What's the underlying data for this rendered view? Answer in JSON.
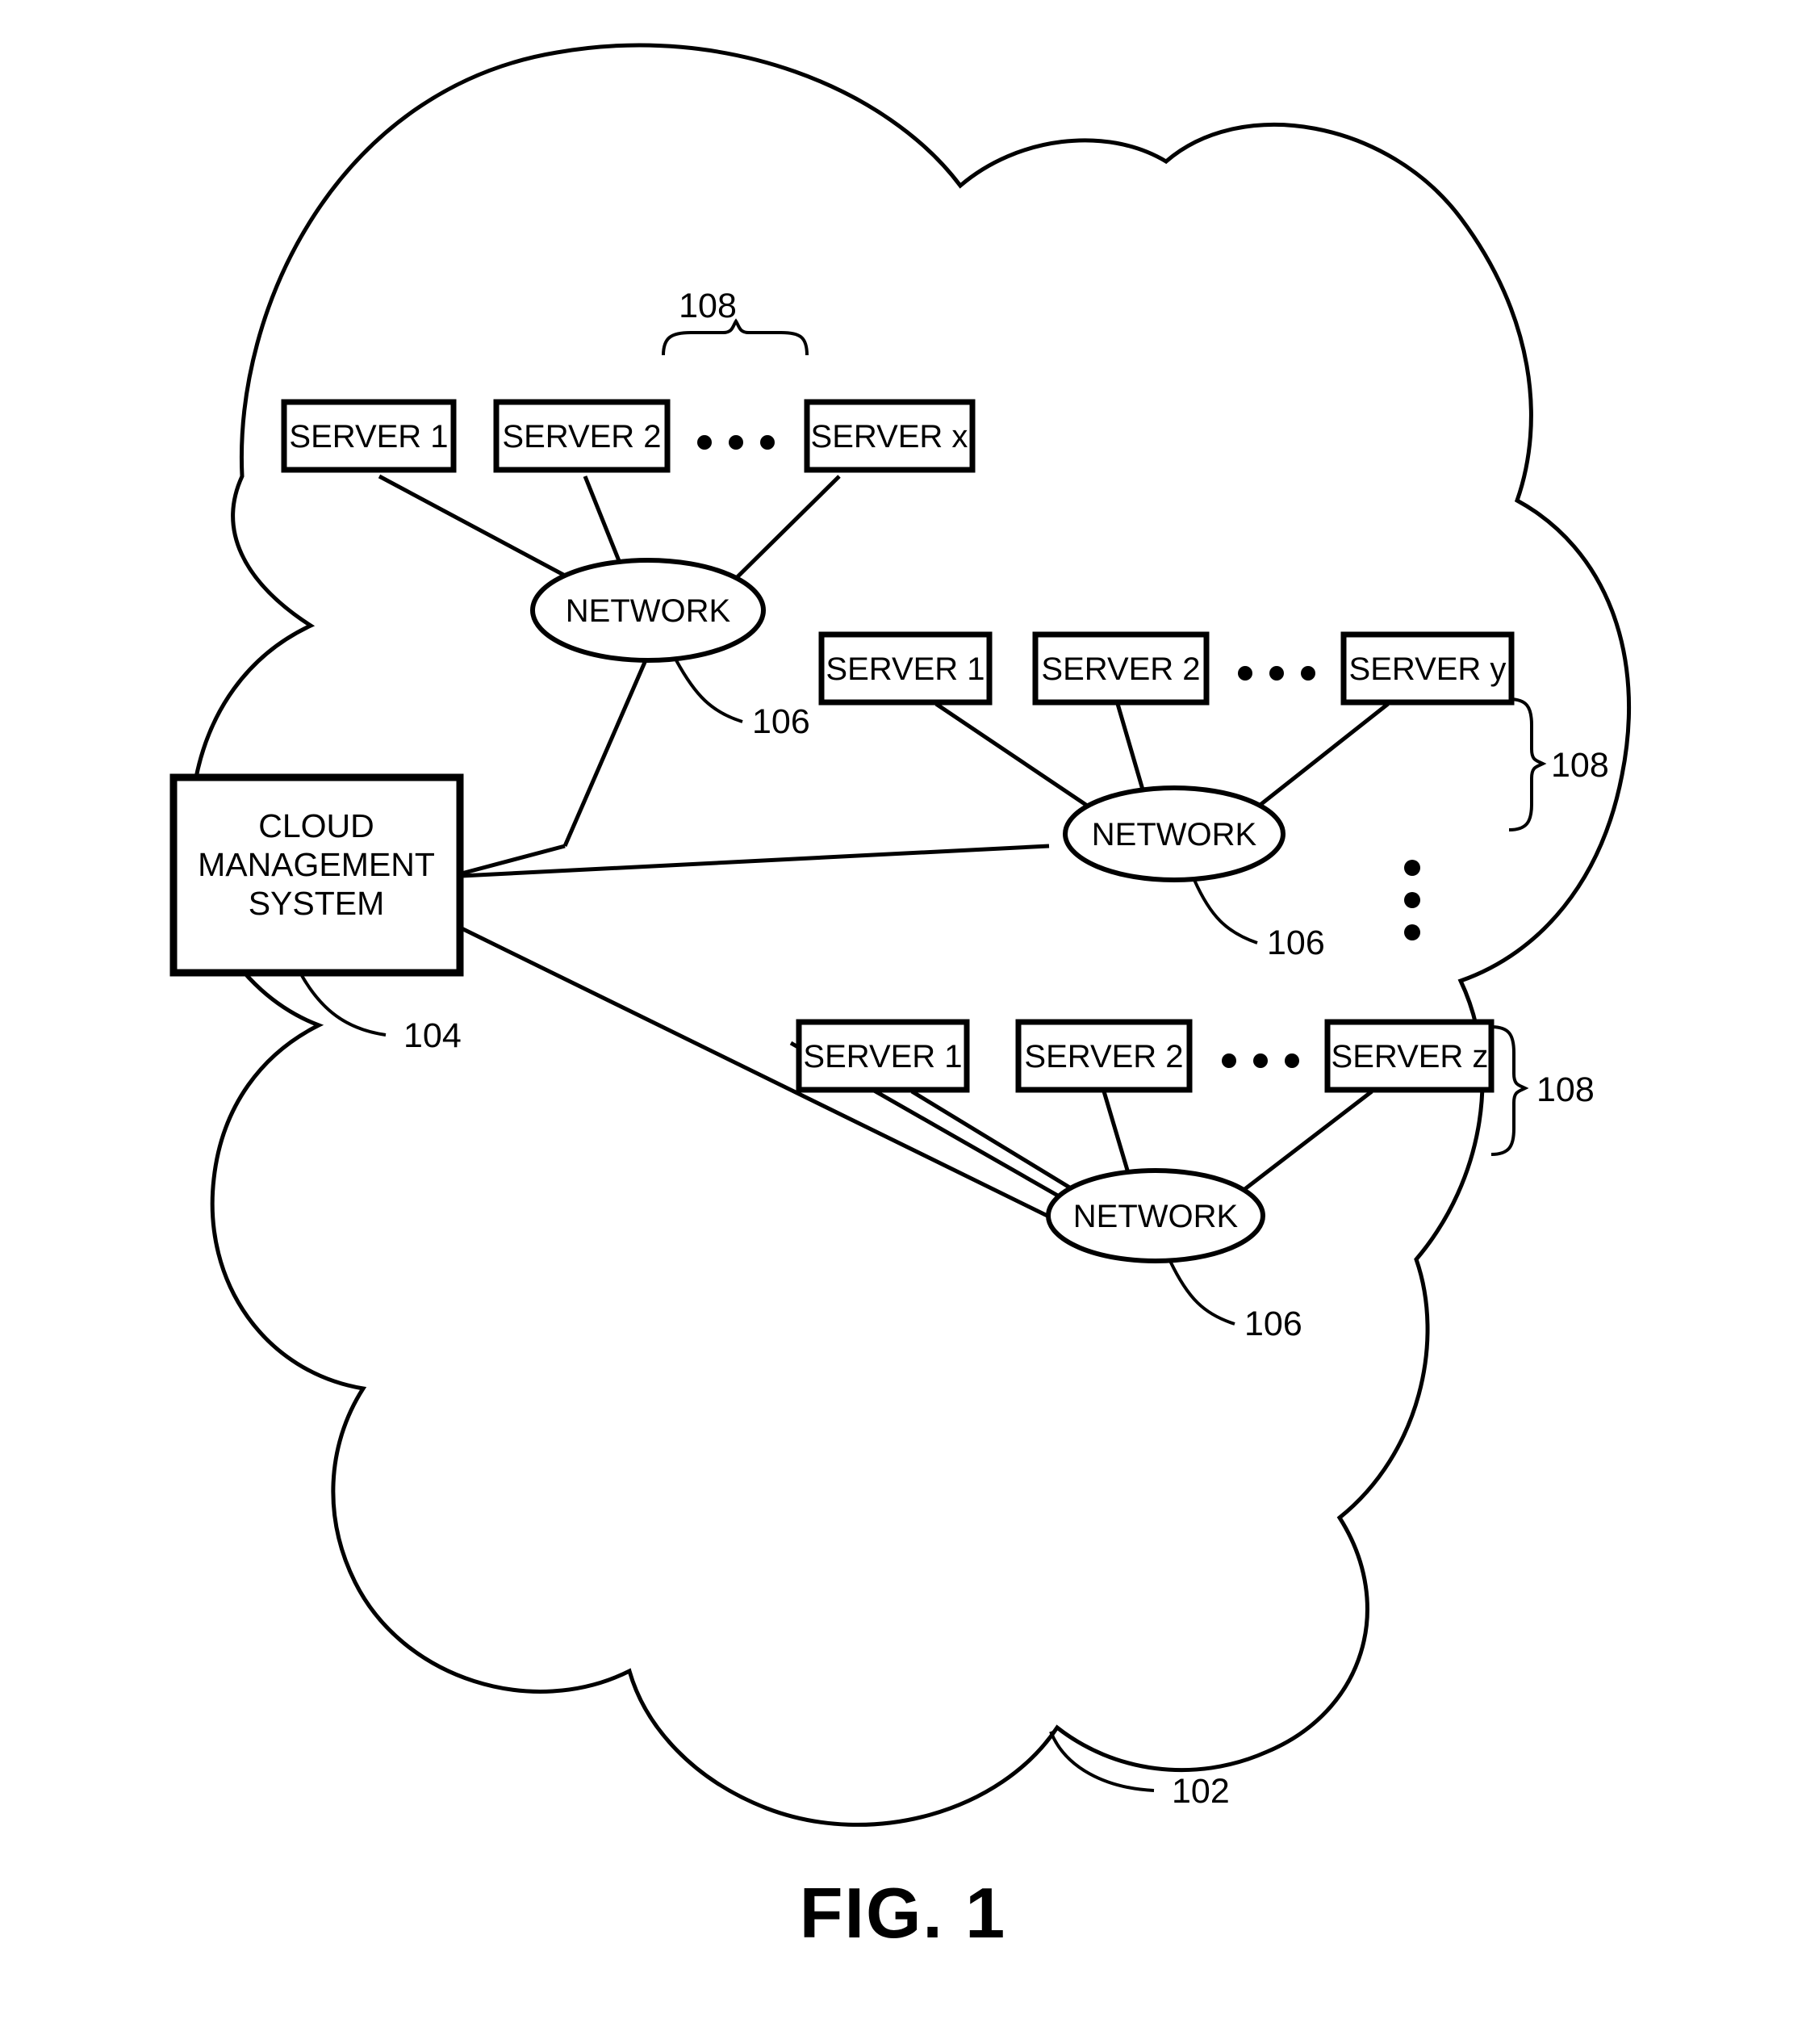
{
  "figure": {
    "label": "FIG. 1",
    "cloud_ref": "102",
    "cloud_ref_name": "cloud-boundary"
  },
  "cloud_management_system": {
    "line1": "CLOUD",
    "line2": "MANAGEMENT",
    "line3": "SYSTEM",
    "ref": "104"
  },
  "server_groups": [
    {
      "group_ref": "108",
      "network_label": "NETWORK",
      "network_ref": "106",
      "ellipsis": "• • •",
      "servers": [
        {
          "label": "SERVER 1"
        },
        {
          "label": "SERVER 2"
        },
        {
          "label": "SERVER x"
        }
      ]
    },
    {
      "group_ref": "108",
      "network_label": "NETWORK",
      "network_ref": "106",
      "ellipsis": "• • •",
      "servers": [
        {
          "label": "SERVER 1"
        },
        {
          "label": "SERVER 2"
        },
        {
          "label": "SERVER y"
        }
      ]
    },
    {
      "group_ref": "108",
      "network_label": "NETWORK",
      "network_ref": "106",
      "ellipsis": "• • •",
      "servers": [
        {
          "label": "SERVER 1"
        },
        {
          "label": "SERVER 2"
        },
        {
          "label": "SERVER z"
        }
      ]
    }
  ],
  "vertical_ellipsis": "⋮",
  "colors": {
    "stroke": "#000000",
    "background": "#ffffff"
  }
}
